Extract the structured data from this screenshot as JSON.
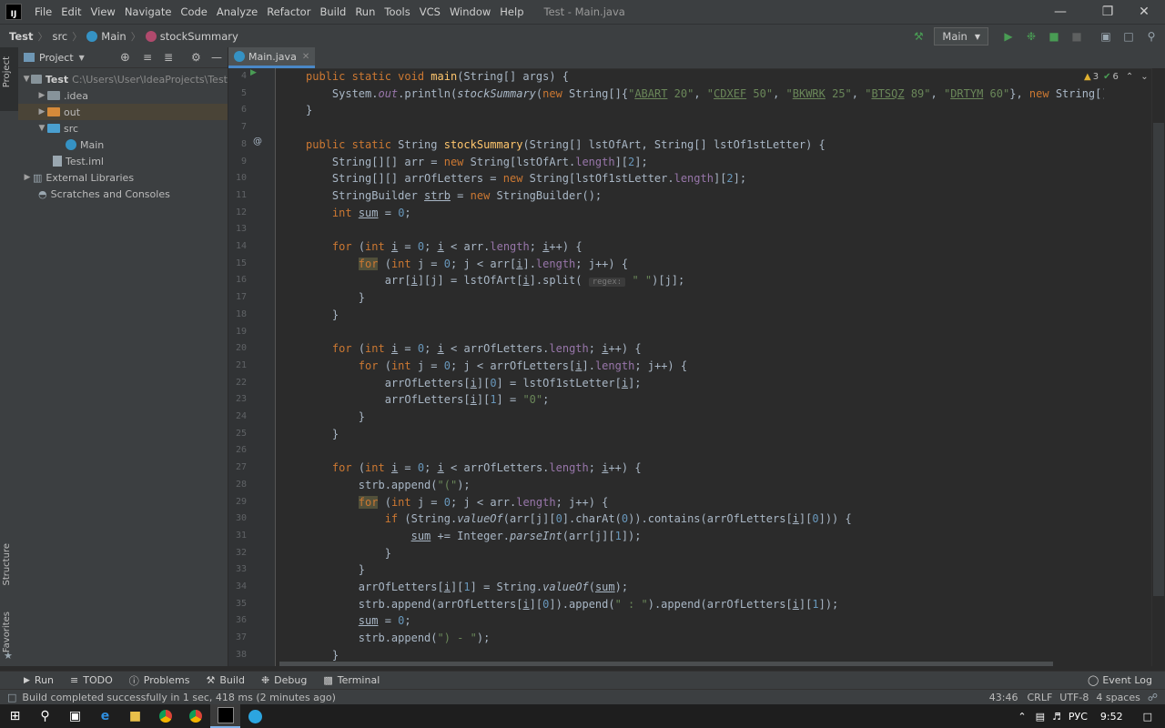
{
  "window": {
    "menu": [
      "File",
      "Edit",
      "View",
      "Navigate",
      "Code",
      "Analyze",
      "Refactor",
      "Build",
      "Run",
      "Tools",
      "VCS",
      "Window",
      "Help"
    ],
    "title": "Test - Main.java"
  },
  "breadcrumb": [
    "Test",
    "src",
    "Main",
    "stockSummary"
  ],
  "toolbar": {
    "run_config": "Main"
  },
  "project_panel": {
    "title": "Project",
    "tree": [
      {
        "label": "Test",
        "path": "C:\\Users\\User\\IdeaProjects\\Test"
      },
      {
        "label": ".idea"
      },
      {
        "label": "out"
      },
      {
        "label": "src"
      },
      {
        "label": "Main"
      },
      {
        "label": "Test.iml"
      },
      {
        "label": "External Libraries"
      },
      {
        "label": "Scratches and Consoles"
      }
    ]
  },
  "left_strip": {
    "project": "Project",
    "structure": "Structure",
    "favorites": "Favorites"
  },
  "editor": {
    "tab": "Main.java",
    "inspections": {
      "warnings": "3",
      "ok": "6"
    },
    "line_numbers": [
      "4",
      "5",
      "6",
      "7",
      "8",
      "9",
      "10",
      "11",
      "12",
      "13",
      "14",
      "15",
      "16",
      "17",
      "18",
      "19",
      "20",
      "21",
      "22",
      "23",
      "24",
      "25",
      "26",
      "27",
      "28",
      "29",
      "30",
      "31",
      "32",
      "33",
      "34",
      "35",
      "36",
      "37",
      "38"
    ]
  },
  "bottom_tabs": [
    "Run",
    "TODO",
    "Problems",
    "Build",
    "Debug",
    "Terminal"
  ],
  "event_log": "Event Log",
  "status": {
    "message": "Build completed successfully in 1 sec, 418 ms (2 minutes ago)",
    "position": "43:46",
    "line_sep": "CRLF",
    "encoding": "UTF-8",
    "indent": "4 spaces"
  },
  "taskbar": {
    "lang": "РУС",
    "time": "9:52"
  },
  "colors": {
    "accent": "#4a88c7",
    "keyword": "#cc7832",
    "string": "#6a8759",
    "number": "#6897bb",
    "function": "#ffc66d"
  }
}
